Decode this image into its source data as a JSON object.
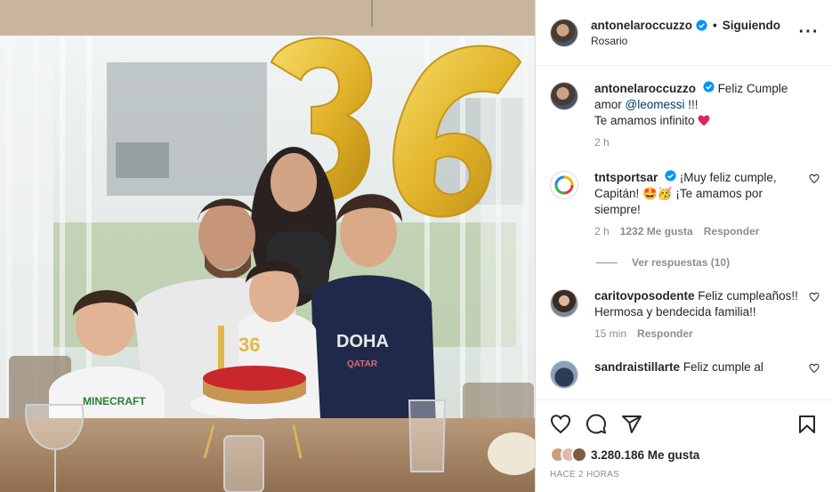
{
  "post": {
    "image_alt": "Family birthday photo with gold 36 balloons and a strawberry cake"
  },
  "header": {
    "username": "antonelaroccuzzo",
    "follow_label": "Siguiendo",
    "location": "Rosario"
  },
  "caption": {
    "username": "antonelaroccuzzo",
    "text_before": "Feliz Cumple amor",
    "mention": "@leomessi",
    "text_after": "!!!",
    "line2": "Te amamos infinito",
    "time": "2 h"
  },
  "comments": [
    {
      "username": "tntsportsar",
      "text": "¡Muy feliz cumple, Capitán! 🤩🥳 ¡Te amamos por siempre!",
      "time": "2 h",
      "likes": "1232 Me gusta",
      "reply": "Responder",
      "view_replies": "Ver respuestas (10)"
    },
    {
      "username": "caritovposodente",
      "text": "Feliz cumpleaños!! Hermosa y bendecida familia!!",
      "time": "15 min",
      "reply": "Responder"
    },
    {
      "username": "sandraistillarte",
      "text": "Feliz cumple al"
    }
  ],
  "actions": {
    "likes_count": "3.280.186 Me gusta",
    "posted_ago": "HACE 2 HORAS"
  },
  "balloon_text": "36",
  "cake_topper": "36",
  "shirt_text_kid_left": "MINECRAFT",
  "shirt_text_kid_right": "DOHA QATAR",
  "colors": {
    "verified_blue": "#0095f6",
    "balloon_gold": "#e9c13a",
    "heart_red": "#ed4956"
  }
}
